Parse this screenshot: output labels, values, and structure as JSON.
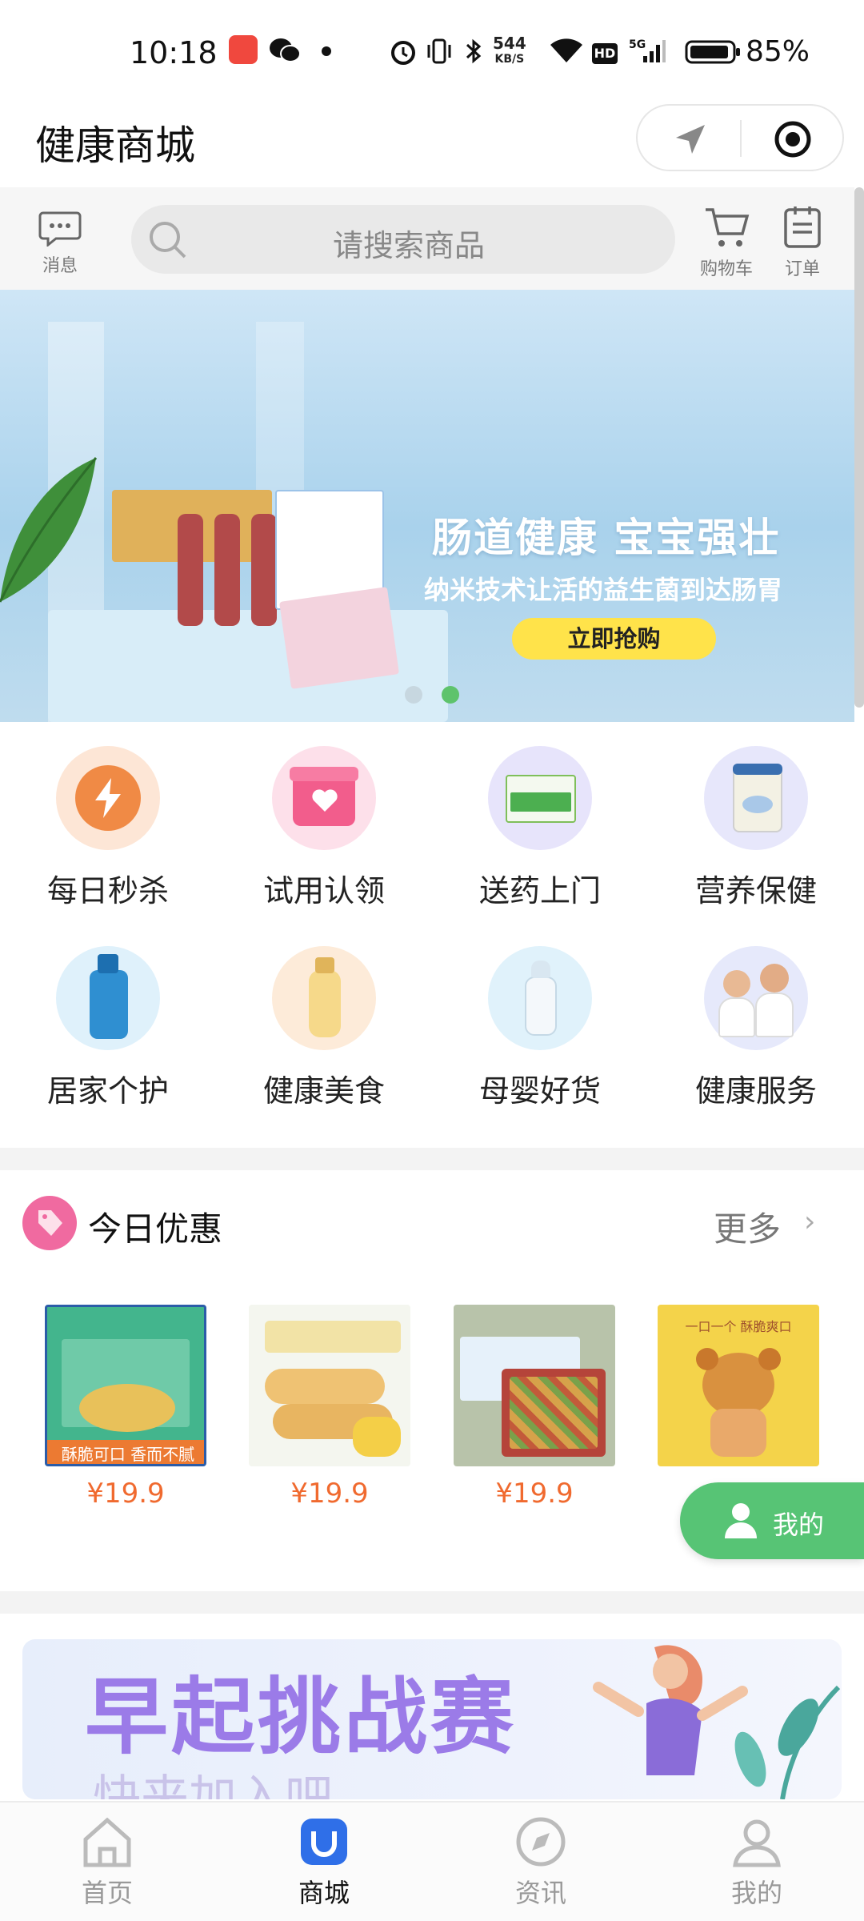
{
  "status_bar": {
    "time": "10:18",
    "net_speed_value": "544",
    "net_speed_unit": "KB/S",
    "battery": "85%",
    "icons": [
      "app-icon",
      "wechat-icon",
      "dot-icon",
      "alarm-icon",
      "vibrate-icon",
      "bluetooth-icon",
      "net-speed-icon",
      "wifi-icon",
      "hd-icon",
      "signal-5g-icon",
      "battery-icon"
    ]
  },
  "header": {
    "title": "健康商城",
    "capsule_icons": [
      "location-arrow-icon",
      "target-icon"
    ]
  },
  "search_row": {
    "message_label": "消息",
    "placeholder": "请搜索商品",
    "cart_label": "购物车",
    "orders_label": "订单"
  },
  "banner": {
    "headline": "肠道健康 宝宝强壮",
    "subline": "纳米技术让活的益生菌到达肠胃",
    "cta": "立即抢购",
    "dots": 2,
    "active_dot": 1
  },
  "categories": [
    {
      "label": "每日秒杀",
      "icon": "lightning-clock-icon",
      "bg": "#fde6d6"
    },
    {
      "label": "试用认领",
      "icon": "gift-heart-icon",
      "bg": "#fde0ea"
    },
    {
      "label": "送药上门",
      "icon": "medicine-box-icon",
      "bg": "#e7e4fb"
    },
    {
      "label": "营养保健",
      "icon": "nutrition-can-icon",
      "bg": "#e7e7fb"
    },
    {
      "label": "居家个护",
      "icon": "shampoo-bottle-icon",
      "bg": "#dff1fb"
    },
    {
      "label": "健康美食",
      "icon": "drink-bottle-icon",
      "bg": "#fdebd9"
    },
    {
      "label": "母婴好货",
      "icon": "baby-bottle-icon",
      "bg": "#e0f2fb"
    },
    {
      "label": "健康服务",
      "icon": "doctors-icon",
      "bg": "#e6e9fb"
    }
  ],
  "deals": {
    "title": "今日优惠",
    "more": "更多",
    "products": [
      {
        "price": "¥19.9",
        "image": "crispy-snack-box-image",
        "caption": "酥脆可口 香而不腻"
      },
      {
        "price": "¥19.9",
        "image": "corn-rolls-image"
      },
      {
        "price": "¥19.9",
        "image": "nut-cake-box-image"
      },
      {
        "price": "",
        "image": "bear-biscuit-image",
        "caption": "一口一个 酥脆爽口"
      }
    ]
  },
  "floating_button": {
    "label": "我的"
  },
  "challenge_banner": {
    "headline": "早起挑战赛",
    "subline": "快来加入吧"
  },
  "tab_bar": {
    "active": 1,
    "tabs": [
      {
        "label": "首页",
        "icon": "home-icon"
      },
      {
        "label": "商城",
        "icon": "mall-bag-icon"
      },
      {
        "label": "资讯",
        "icon": "compass-icon"
      },
      {
        "label": "我的",
        "icon": "profile-icon"
      }
    ]
  },
  "colors": {
    "accent_blue": "#2f6fe8",
    "price_orange": "#f06a2f",
    "fab_green": "#57c475",
    "cta_yellow": "#ffe34a",
    "challenge_purple": "#9b7be8"
  }
}
